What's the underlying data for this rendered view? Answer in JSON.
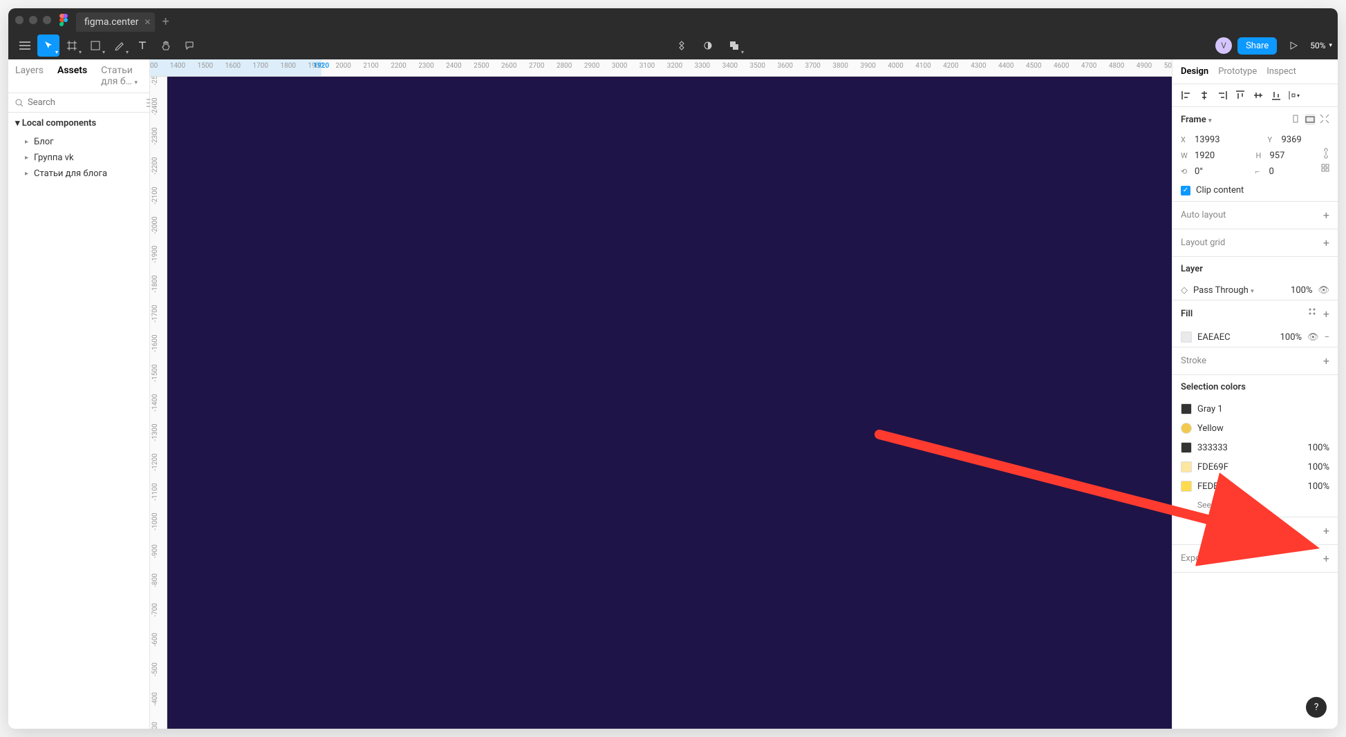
{
  "tab_title": "figma.center",
  "toolbar": {
    "share_label": "Share",
    "zoom": "50%"
  },
  "left_panel": {
    "tabs": [
      "Layers",
      "Assets",
      "Статьи для б…"
    ],
    "active_tab": 1,
    "search_placeholder": "Search",
    "heading": "Local components",
    "items": [
      "Блог",
      "Группа vk",
      "Статьи для блога"
    ]
  },
  "ruler_h": {
    "start": 1300,
    "end": 5000,
    "step": 100,
    "selection": {
      "start": 1300,
      "end": 1920,
      "label": "1920"
    }
  },
  "ruler_v": {
    "start": -2500,
    "end": -300,
    "step": 100
  },
  "right_panel": {
    "tabs": [
      "Design",
      "Prototype",
      "Inspect"
    ],
    "active_tab": 0,
    "frame": {
      "label": "Frame",
      "x": "13993",
      "y": "9369",
      "w": "1920",
      "h": "957",
      "rotation": "0°",
      "radius": "0",
      "clip_content_label": "Clip content"
    },
    "auto_layout_label": "Auto layout",
    "layout_grid_label": "Layout grid",
    "layer": {
      "label": "Layer",
      "blend": "Pass Through",
      "opacity": "100%"
    },
    "fill": {
      "label": "Fill",
      "hex": "EAEAEC",
      "opacity": "100%"
    },
    "stroke_label": "Stroke",
    "selection_colors": {
      "label": "Selection colors",
      "items": [
        {
          "name": "Gray 1",
          "hex": "333333",
          "opacity": null,
          "swatch": "#333333"
        },
        {
          "name": "Yellow",
          "hex": null,
          "opacity": null,
          "swatch": "#f2c94c"
        },
        {
          "name": null,
          "hex": "333333",
          "opacity": "100%",
          "swatch": "#333333"
        },
        {
          "name": null,
          "hex": "FDE69F",
          "opacity": "100%",
          "swatch": "#fde69f"
        },
        {
          "name": null,
          "hex": "FEDB4D",
          "opacity": "100%",
          "swatch": "#fedb4d"
        }
      ],
      "see_all": "See all 5 colors"
    },
    "export_label": "Export"
  },
  "help_label": "?"
}
